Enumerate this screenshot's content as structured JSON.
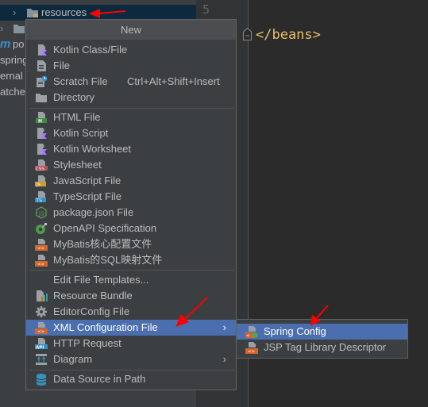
{
  "project_tree": {
    "rows": [
      {
        "label": "resources",
        "selected": true
      },
      {
        "label": ""
      },
      {
        "label": "po"
      },
      {
        "label": "spring"
      },
      {
        "label": "ernal l"
      },
      {
        "label": "atches"
      }
    ]
  },
  "editor": {
    "line_number": "5",
    "code": "</beans>",
    "code_color": "#e8bf6a"
  },
  "new_menu": {
    "title": "New",
    "items": [
      {
        "label": "Kotlin Class/File",
        "icon": "kotlin-file-icon"
      },
      {
        "label": "File",
        "icon": "file-icon"
      },
      {
        "label": "Scratch File",
        "icon": "scratch-file-icon",
        "shortcut": "Ctrl+Alt+Shift+Insert"
      },
      {
        "label": "Directory",
        "icon": "folder-icon"
      },
      {
        "label": "HTML File",
        "icon": "html-file-icon"
      },
      {
        "label": "Kotlin Script",
        "icon": "kotlin-script-icon"
      },
      {
        "label": "Kotlin Worksheet",
        "icon": "kotlin-worksheet-icon"
      },
      {
        "label": "Stylesheet",
        "icon": "css-file-icon"
      },
      {
        "label": "JavaScript File",
        "icon": "js-file-icon"
      },
      {
        "label": "TypeScript File",
        "icon": "ts-file-icon"
      },
      {
        "label": "package.json File",
        "icon": "nodejs-icon"
      },
      {
        "label": "OpenAPI Specification",
        "icon": "openapi-icon"
      },
      {
        "label": "MyBatis核心配置文件",
        "icon": "xml-file-icon"
      },
      {
        "label": "MyBatis的SQL映射文件",
        "icon": "xml-file-icon"
      },
      {
        "label": "Edit File Templates...",
        "icon": ""
      },
      {
        "label": "Resource Bundle",
        "icon": "resource-bundle-icon"
      },
      {
        "label": "EditorConfig File",
        "icon": "gear-icon"
      },
      {
        "label": "XML Configuration File",
        "icon": "xml-file-icon",
        "submenu": true,
        "highlighted": true
      },
      {
        "label": "HTTP Request",
        "icon": "api-file-icon"
      },
      {
        "label": "Diagram",
        "icon": "diagram-icon",
        "submenu": true
      },
      {
        "label": "Data Source in Path",
        "icon": "database-icon"
      }
    ],
    "submenu_arrow": "›"
  },
  "xml_submenu": {
    "items": [
      {
        "label": "Spring Config",
        "icon": "spring-xml-icon",
        "highlighted": true
      },
      {
        "label": "JSP Tag Library Descriptor",
        "icon": "xml-file-icon"
      }
    ]
  },
  "colors": {
    "highlight": "#4b6eaf",
    "annotation_arrow": "#ff0000"
  }
}
